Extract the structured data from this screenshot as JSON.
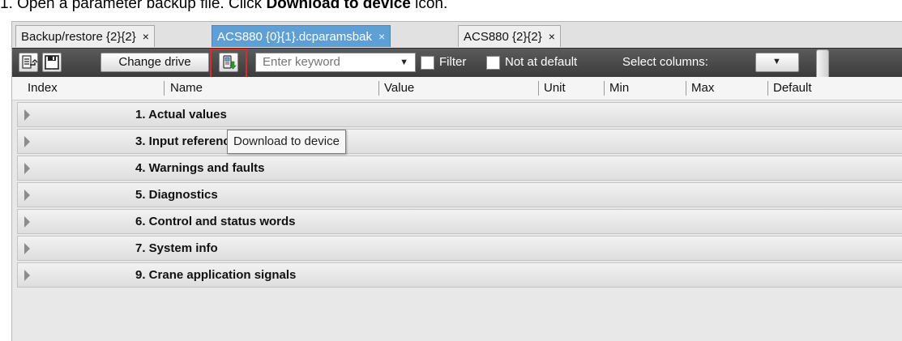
{
  "instruction": {
    "prefix": "1.   Open a parameter backup file. Click ",
    "bold": "Download to device",
    "suffix": " icon."
  },
  "tabs": [
    {
      "label": "Backup/restore {2}{2}",
      "close": "×",
      "active": false
    },
    {
      "label": "ACS880 {0}{1}.dcparamsbak",
      "close": "×",
      "active": true
    },
    {
      "label": "ACS880 {2}{2}",
      "close": "×",
      "active": false
    }
  ],
  "toolbar": {
    "change_drive": "Change drive",
    "search_placeholder": "Enter keyword",
    "filter_label": "Filter",
    "not_default_label": "Not at default",
    "select_columns_label": "Select columns:"
  },
  "columns": [
    "Index",
    "Name",
    "Value",
    "Unit",
    "Min",
    "Max",
    "Default"
  ],
  "tooltip": "Download to device",
  "groups": [
    "1. Actual values",
    "3. Input references",
    "4. Warnings and faults",
    "5. Diagnostics",
    "6. Control and status words",
    "7. System info",
    "9. Crane application signals"
  ],
  "colors": {
    "active_tab": "#5e9fd6",
    "toolbar": "#4a4a4a",
    "highlight": "#d92b2b"
  }
}
